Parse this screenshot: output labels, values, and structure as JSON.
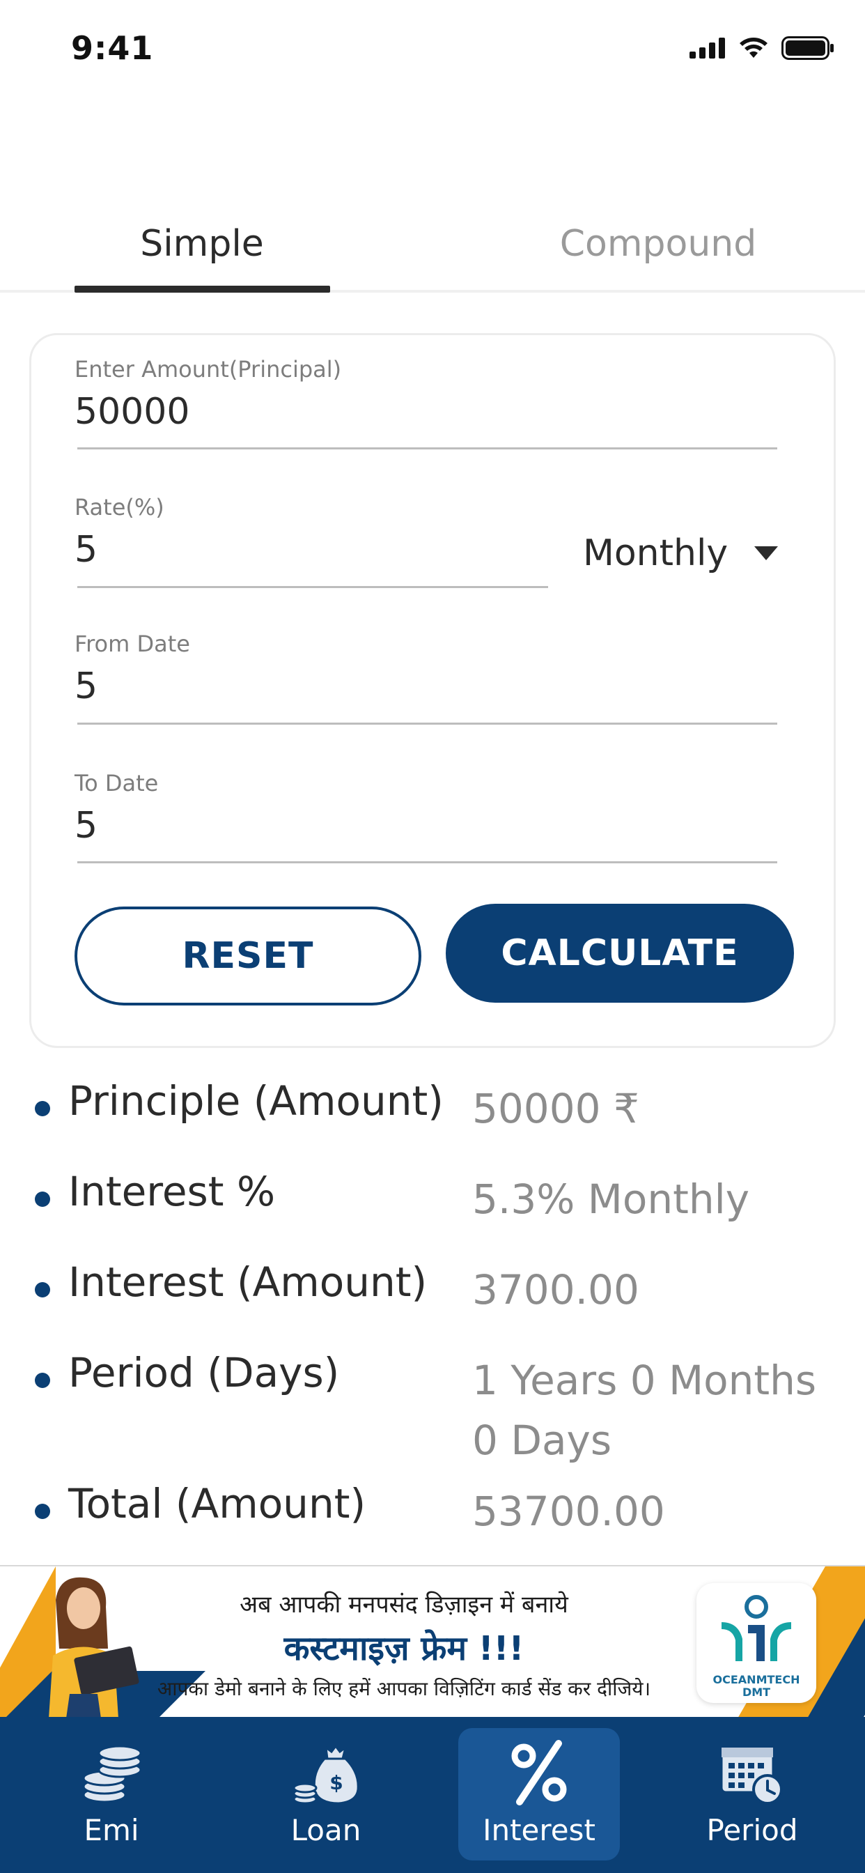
{
  "status_bar": {
    "time": "9:41"
  },
  "tabs": [
    {
      "label": "Simple",
      "active": true
    },
    {
      "label": "Compound",
      "active": false
    }
  ],
  "form": {
    "principal": {
      "label": "Enter Amount(Principal)",
      "value": "50000"
    },
    "rate": {
      "label": "Rate(%)",
      "value": "5",
      "period_selected": "Monthly"
    },
    "from_date": {
      "label": "From Date",
      "value": "5"
    },
    "to_date": {
      "label": "To Date",
      "value": "5"
    },
    "reset_label": "RESET",
    "calculate_label": "CALCULATE"
  },
  "results": [
    {
      "label": "Principle (Amount)",
      "value": "50000 ₹"
    },
    {
      "label": "Interest %",
      "value": "5.3% Monthly"
    },
    {
      "label": "Interest (Amount)",
      "value": "3700.00"
    },
    {
      "label": "Period (Days)",
      "value": "1 Years 0 Months",
      "value2": "0 Days"
    },
    {
      "label": "Total (Amount)",
      "value": "53700.00"
    }
  ],
  "banner": {
    "line1": "अब आपकी मनपसंद डिज़ाइन में बनाये",
    "line2": "कस्टमाइज़ फ्रेम !!!",
    "line3": "आपका डेमो बनाने के लिए हमें आपका विज़िटिंग कार्ड सेंड कर दीजिये।",
    "logo_text_1": "OCEANMTECH",
    "logo_text_2": "DMT"
  },
  "bottom_nav": [
    {
      "label": "Emi",
      "icon": "coins-stack-icon",
      "active": false
    },
    {
      "label": "Loan",
      "icon": "money-bag-icon",
      "active": false
    },
    {
      "label": "Interest",
      "icon": "percent-icon",
      "active": true
    },
    {
      "label": "Period",
      "icon": "calendar-clock-icon",
      "active": false
    }
  ],
  "colors": {
    "primary": "#0b3f74",
    "nav_active": "#1a5796",
    "accent": "#f2a51c",
    "text": "#2b2b2b",
    "muted": "#8c8c8c"
  }
}
